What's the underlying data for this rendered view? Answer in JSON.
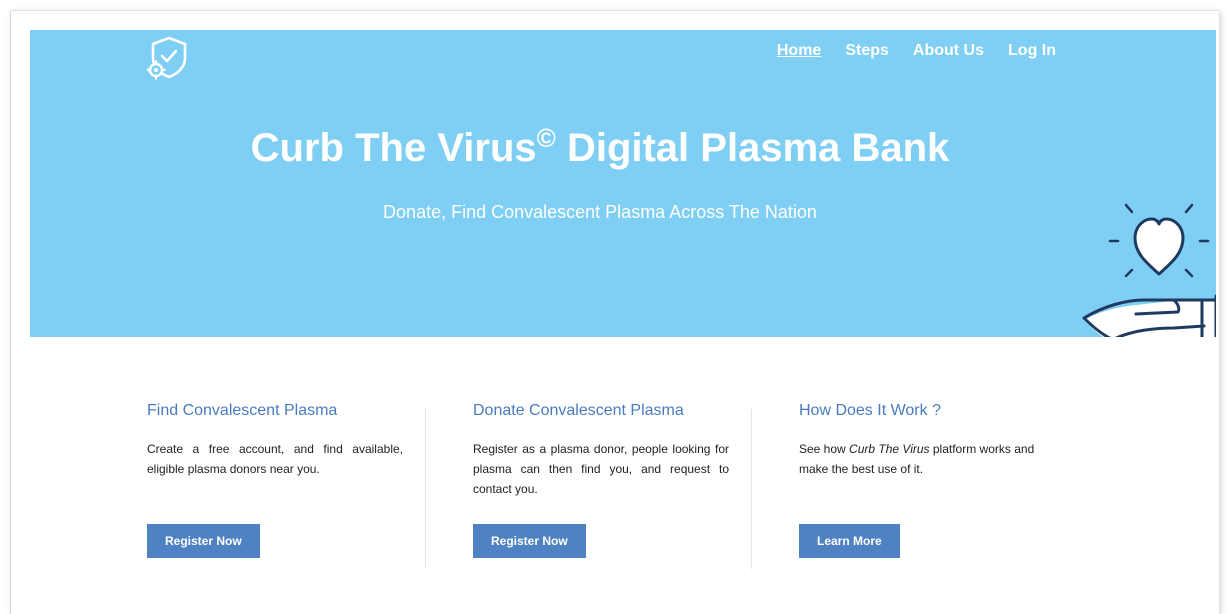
{
  "nav": {
    "items": [
      {
        "label": "Home",
        "active": true
      },
      {
        "label": "Steps",
        "active": false
      },
      {
        "label": "About Us",
        "active": false
      },
      {
        "label": "Log In",
        "active": false
      }
    ]
  },
  "hero": {
    "title": "Curb The Virus",
    "title_mark": "©",
    "title_rest": " Digital Plasma Bank",
    "subtitle": "Donate, Find Convalescent Plasma Across The Nation"
  },
  "features": [
    {
      "heading": "Find Convalescent Plasma",
      "description": "Create a free account, and find available, eligible plasma donors near you.",
      "button_label": "Register Now"
    },
    {
      "heading": "Donate Convalescent Plasma",
      "description": "Register as a plasma donor, people looking for plasma can then find you, and request to contact you.",
      "button_label": "Register Now"
    },
    {
      "heading": "How Does It Work ?",
      "description_before": "See how ",
      "description_em": "Curb The Virus",
      "description_after": " platform works and make the best use of it.",
      "button_label": "Learn More"
    }
  ],
  "colors": {
    "hero_bg": "#7ecff3",
    "heading": "#4a7bbf",
    "button": "#4f82c3",
    "icon_stroke": "#1f3a5f"
  },
  "icons": [
    "shield-gear-logo-icon",
    "heart-in-hand-icon"
  ]
}
